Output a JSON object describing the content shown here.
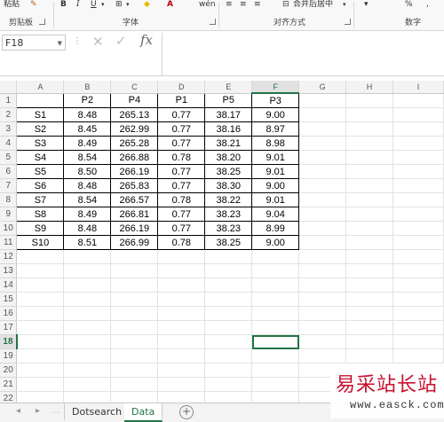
{
  "ribbon": {
    "groups": [
      {
        "label": "剪贴板"
      },
      {
        "label": "字体"
      },
      {
        "label": "对齐方式"
      },
      {
        "label": "数字"
      }
    ],
    "top_items": {
      "paste": "粘贴",
      "bold": "B",
      "italic": "I",
      "underline": "U",
      "merge_center": "合并后居中",
      "percent": "%"
    }
  },
  "formula_bar": {
    "name_box": "F18",
    "fx": "fx",
    "value": ""
  },
  "columns": [
    "A",
    "B",
    "C",
    "D",
    "E",
    "F",
    "G",
    "H",
    "I"
  ],
  "selected": {
    "col": "F",
    "row": "18"
  },
  "rows": [
    {
      "n": "1",
      "cells": [
        "",
        "P2",
        "P4",
        "P1",
        "P5",
        "P3"
      ]
    },
    {
      "n": "2",
      "cells": [
        "S1",
        "8.48",
        "265.13",
        "0.77",
        "38.17",
        "9.00"
      ]
    },
    {
      "n": "3",
      "cells": [
        "S2",
        "8.45",
        "262.99",
        "0.77",
        "38.16",
        "8.97"
      ]
    },
    {
      "n": "4",
      "cells": [
        "S3",
        "8.49",
        "265.28",
        "0.77",
        "38.21",
        "8.98"
      ]
    },
    {
      "n": "5",
      "cells": [
        "S4",
        "8.54",
        "266.88",
        "0.78",
        "38.20",
        "9.01"
      ]
    },
    {
      "n": "6",
      "cells": [
        "S5",
        "8.50",
        "266.19",
        "0.77",
        "38.25",
        "9.01"
      ]
    },
    {
      "n": "7",
      "cells": [
        "S6",
        "8.48",
        "265.83",
        "0.77",
        "38.30",
        "9.00"
      ]
    },
    {
      "n": "8",
      "cells": [
        "S7",
        "8.54",
        "266.57",
        "0.78",
        "38.22",
        "9.01"
      ]
    },
    {
      "n": "9",
      "cells": [
        "S8",
        "8.49",
        "266.81",
        "0.77",
        "38.23",
        "9.04"
      ]
    },
    {
      "n": "10",
      "cells": [
        "S9",
        "8.48",
        "266.19",
        "0.77",
        "38.23",
        "8.99"
      ]
    },
    {
      "n": "11",
      "cells": [
        "S10",
        "8.51",
        "266.99",
        "0.78",
        "38.25",
        "9.00"
      ]
    },
    {
      "n": "12",
      "cells": []
    },
    {
      "n": "13",
      "cells": []
    },
    {
      "n": "14",
      "cells": []
    },
    {
      "n": "15",
      "cells": []
    },
    {
      "n": "16",
      "cells": []
    },
    {
      "n": "17",
      "cells": []
    },
    {
      "n": "18",
      "cells": []
    },
    {
      "n": "19",
      "cells": []
    },
    {
      "n": "20",
      "cells": []
    },
    {
      "n": "21",
      "cells": []
    },
    {
      "n": "22",
      "cells": []
    }
  ],
  "sheet_tabs": [
    {
      "label": "Dotsearch",
      "active": false
    },
    {
      "label": "Data",
      "active": true
    }
  ],
  "add_sheet": "+",
  "watermark": {
    "text": "易采站长站",
    "url": "www.easck.com"
  },
  "colors": {
    "accent": "#217346",
    "watermark": "#c8102e"
  }
}
